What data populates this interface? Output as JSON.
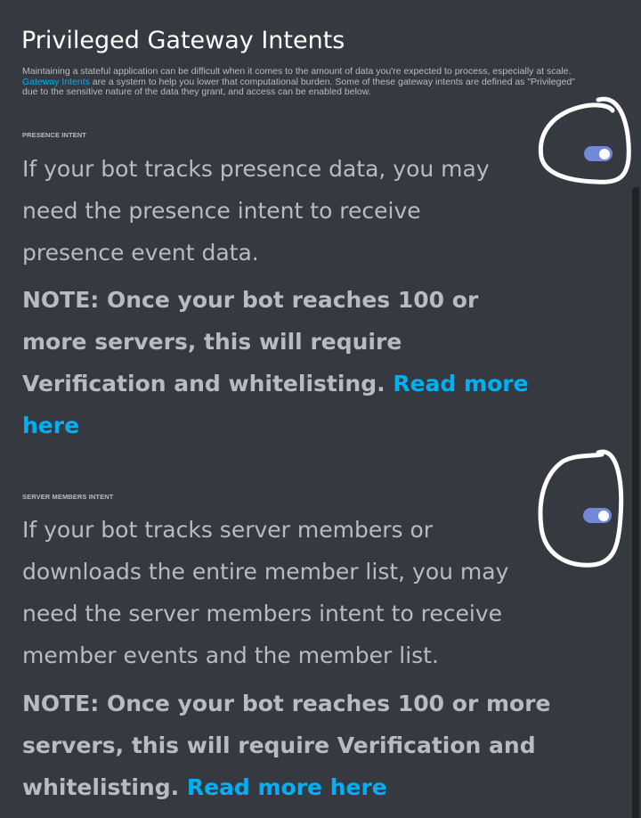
{
  "header": {
    "title": "Privileged Gateway Intents",
    "intro_line1": "Maintaining a stateful application can be difficult when it comes to the amount of data you're expected to process, especially at scale.",
    "intro_link": "Gateway Intents",
    "intro_line2_rest": " are a system to help you lower that computational burden. Some of these gateway intents are defined as \"Privileged\"",
    "intro_line3": "due to the sensitive nature of the data they grant, and access can be enabled below."
  },
  "presence": {
    "label": "PRESENCE INTENT",
    "toggle_state": "on",
    "desc_lines": [
      "If your bot tracks presence data, you may",
      "need the presence intent to receive",
      "presence event data."
    ],
    "note_lines": [
      "NOTE: Once your bot reaches 100 or",
      "more servers, this will require",
      "Verification and whitelisting."
    ],
    "read_more_part1": "Read more",
    "read_more_part2": "here"
  },
  "members": {
    "label": "SERVER MEMBERS INTENT",
    "toggle_state": "on",
    "desc_lines": [
      "If your bot tracks server members or",
      "downloads the entire member list, you may",
      "need the server members intent to receive",
      "member events and the member list."
    ],
    "note_lines": [
      "NOTE: Once your bot reaches 100 or more",
      "servers, this will require Verification and",
      "whitelisting."
    ],
    "read_more": "Read more here"
  },
  "colors": {
    "background": "#36393f",
    "text_muted": "#b9bbbe",
    "link": "#00b0f4",
    "toggle_on": "#7289da",
    "annotation": "#ffffff"
  },
  "annotations": [
    "hand-drawn circle around presence toggle",
    "hand-drawn circle around members toggle"
  ]
}
